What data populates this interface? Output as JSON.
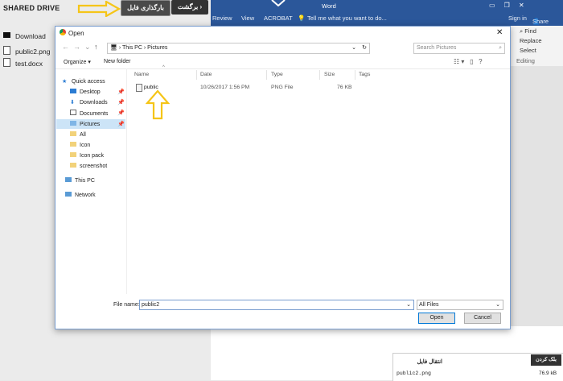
{
  "drive": {
    "title": "SHARED DRIVE",
    "upload_label": "بارگذاری فایل",
    "back_label": "برگشت",
    "files": [
      "Download",
      "public2.png",
      "test.docx"
    ]
  },
  "word": {
    "title_fragment": "Word",
    "tabs": [
      "Review",
      "View",
      "ACROBAT"
    ],
    "tell_me": "Tell me what you want to do...",
    "sign_in": "Sign in",
    "share": "Share",
    "ribbon": [
      "Find",
      "Replace",
      "Select",
      "Editing"
    ]
  },
  "transfer": {
    "title": "انتقال فایل",
    "cancel_label": "بلک کردن",
    "file_name": "public2.png",
    "file_size": "76.9 kB"
  },
  "dialog": {
    "title": "Open",
    "breadcrumb": [
      "This PC",
      "Pictures"
    ],
    "search_placeholder": "Search Pictures",
    "organize": "Organize",
    "new_folder": "New folder",
    "nav": [
      "Quick access",
      "Desktop",
      "Downloads",
      "Documents",
      "Pictures",
      "All",
      "Icon",
      "Icon pack",
      "screenshot",
      "This PC",
      "Network"
    ],
    "columns": [
      "Name",
      "Date",
      "Type",
      "Size",
      "Tags"
    ],
    "row": {
      "name": "public",
      "date": "10/26/2017 1:56 PM",
      "type": "PNG File",
      "size": "76 KB"
    },
    "file_name_label": "File name:",
    "file_name_value": "public2",
    "file_type": "All Files",
    "open_label": "Open",
    "cancel_label": "Cancel"
  },
  "colors": {
    "word_blue": "#2b579a",
    "arrow_yellow": "#f5c518",
    "selection": "#cce4f7"
  }
}
